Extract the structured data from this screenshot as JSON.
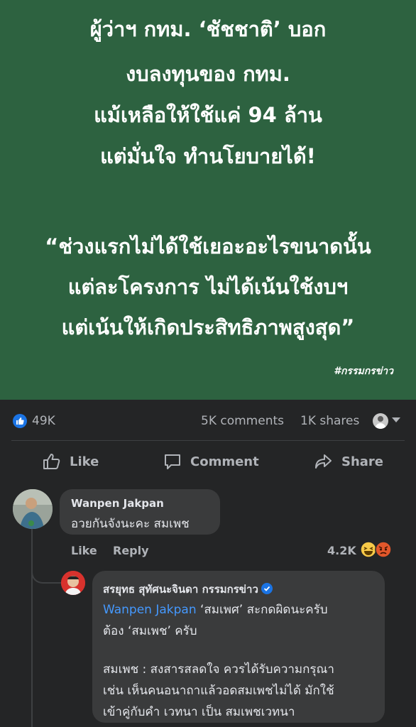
{
  "banner": {
    "headline_lines": [
      "ผู้ว่าฯ กทม. ‘ชัชชาติ’ บอก",
      "งบลงทุนของ กทม.",
      "แม้เหลือให้ใช้แค่ 94 ล้าน",
      "แต่มั่นใจ ทำนโยบายได้!"
    ],
    "quote_lines": [
      "“ช่วงแรกไม่ได้ใช้เยอะอะไรขนาดนั้น",
      "แต่ละโครงการ ไม่ได้เน้นใช้งบฯ",
      "แต่เน้นให้เกิดประสิทธิภาพสูงสุด”"
    ],
    "hashtag": "#กรรมกรข่าว",
    "bg_color": "#2d6240"
  },
  "stats": {
    "likes": "49K",
    "comments": "5K comments",
    "shares": "1K shares"
  },
  "actions": {
    "like": "Like",
    "comment": "Comment",
    "share": "Share"
  },
  "comment": {
    "author": "Wanpen Jakpan",
    "text": "อวยกันจังนะคะ สมเพช",
    "like_label": "Like",
    "reply_label": "Reply",
    "reaction_count": "4.2K",
    "reactions": [
      "laughing-emoji-icon",
      "angry-emoji-icon"
    ]
  },
  "reply": {
    "author": "สรยุทธ สุทัศนะจินดา กรรมกรข่าว",
    "mention": "Wanpen Jakpan",
    "line1_rest": " ‘สมเพศ’ สะกดผิดนะครับ",
    "line2": "ต้อง ‘สมเพช’ ครับ",
    "line3": "สมเพช : สงสารสลดใจ ควรได้รับความกรุณา",
    "line4": "เช่น เห็นคนอนาถาแล้วอดสมเพชไม่ได้ มักใช้",
    "line5": "เข้าคู่กับคำ เวทนา เป็น สมเพชเวทนา"
  }
}
